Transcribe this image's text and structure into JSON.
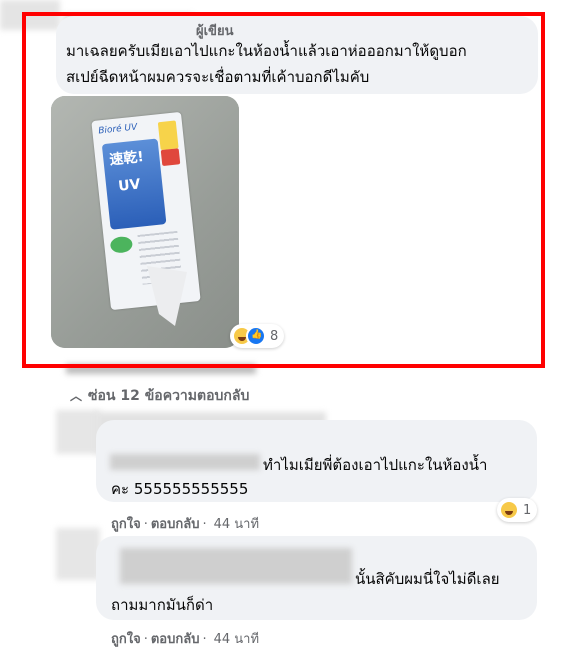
{
  "post_comment": {
    "author_label": "ผู้เขียน",
    "text_line1": "มาเฉลยครับเมียเอาไปแกะในห้องน้ำแล้วเอาห่อออกมาให้ดูบอก",
    "text_line2": "สเปย์ฉีดหน้าผมควรจะเชื่อตามที่เค้าบอกดีไมคับ",
    "photo_brand": "Bioré UV",
    "photo_kanji": "速乾!",
    "photo_uv": "UV",
    "reaction_count": "8"
  },
  "replies_toggle": {
    "label": "ซ่อน 12 ข้อความตอบกลับ"
  },
  "reply1": {
    "text_line1": "ทำไมเมียพี่ต้องเอาไปแกะในห้องน้ำ",
    "text_line2": "คะ 555555555555",
    "reaction_count": "1",
    "like_label": "ถูกใจ",
    "reply_label": "ตอบกลับ",
    "time": "44 นาที"
  },
  "reply2": {
    "text_line1": "นั้นสิคับผมนี่ใจไม่ดีเลย",
    "text_line2": "ถามมากมันก็ด่า",
    "like_label": "ถูกใจ",
    "reply_label": "ตอบกลับ",
    "time": "44 นาที"
  },
  "colors": {
    "highlight": "#ff0000",
    "bubble": "#f0f2f5",
    "secondary_text": "#65676b"
  }
}
